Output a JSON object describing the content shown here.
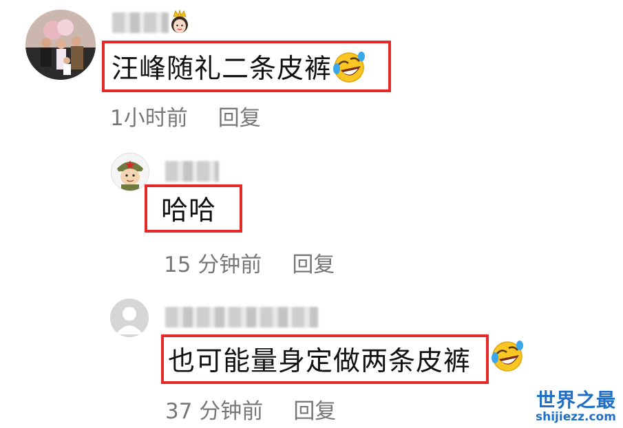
{
  "comments": [
    {
      "text": "汪峰随礼二条皮裤",
      "time": "1小时前",
      "reply_label": "回复",
      "emoji": "laugh-cry-emoji",
      "badge": "crown-princess-emoji"
    },
    {
      "text": "哈哈",
      "time": "15 分钟前",
      "reply_label": "回复"
    },
    {
      "text": "也可能量身定做两条皮裤",
      "time": "37 分钟前",
      "reply_label": "回复",
      "emoji": "laugh-cry-emoji"
    }
  ],
  "watermark": {
    "title": "世界之最",
    "url": "shijiezz.com"
  },
  "colors": {
    "highlight_border": "#e52929",
    "meta_text": "#777777",
    "watermark": "#1f6fc4"
  }
}
